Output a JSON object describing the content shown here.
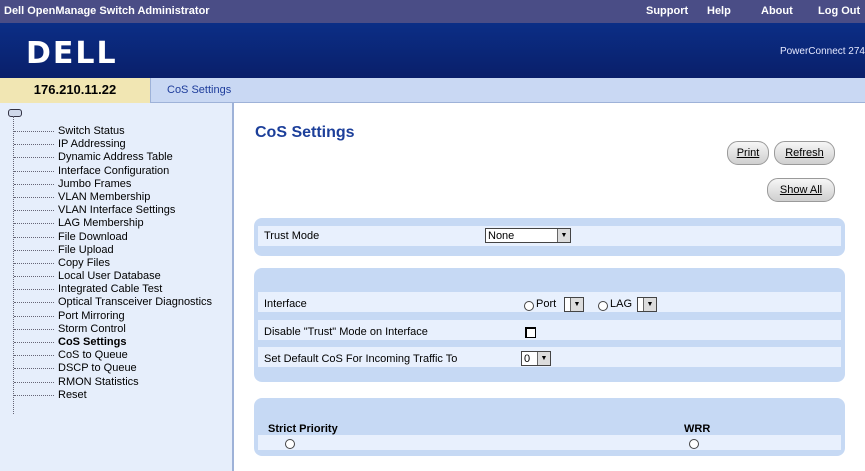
{
  "app": {
    "title": "Dell OpenManage Switch Administrator",
    "nav": [
      "Support",
      "Help",
      "About",
      "Log Out"
    ],
    "logo": "DELL",
    "product": "PowerConnect 274"
  },
  "address": {
    "ip": "176.210.11.22",
    "breadcrumb": "CoS Settings"
  },
  "sidebar": {
    "items": [
      {
        "label": "Switch Status"
      },
      {
        "label": "IP Addressing"
      },
      {
        "label": "Dynamic Address Table"
      },
      {
        "label": "Interface Configuration"
      },
      {
        "label": "Jumbo Frames"
      },
      {
        "label": "VLAN Membership"
      },
      {
        "label": "VLAN Interface Settings"
      },
      {
        "label": "LAG Membership"
      },
      {
        "label": "File Download"
      },
      {
        "label": "File Upload"
      },
      {
        "label": "Copy Files"
      },
      {
        "label": "Local User Database"
      },
      {
        "label": "Integrated Cable Test"
      },
      {
        "label": "Optical Transceiver Diagnostics"
      },
      {
        "label": "Port Mirroring"
      },
      {
        "label": "Storm Control"
      },
      {
        "label": "CoS Settings",
        "active": true
      },
      {
        "label": "CoS to Queue"
      },
      {
        "label": "DSCP to Queue"
      },
      {
        "label": "RMON Statistics"
      },
      {
        "label": "Reset"
      }
    ]
  },
  "main": {
    "title": "CoS Settings",
    "buttons": {
      "print": "Print",
      "refresh": "Refresh",
      "show_all": "Show All"
    },
    "trust_mode": {
      "label": "Trust Mode",
      "value": "None"
    },
    "interface": {
      "label": "Interface",
      "port_label": "Port",
      "lag_label": "LAG",
      "port_value": "",
      "lag_value": ""
    },
    "disable_trust": {
      "label": "Disable \"Trust\" Mode on Interface",
      "checked": false
    },
    "default_cos": {
      "label": "Set Default CoS For Incoming Traffic To",
      "value": "0"
    },
    "scheduling": {
      "strict_priority": "Strict Priority",
      "wrr": "WRR"
    }
  }
}
